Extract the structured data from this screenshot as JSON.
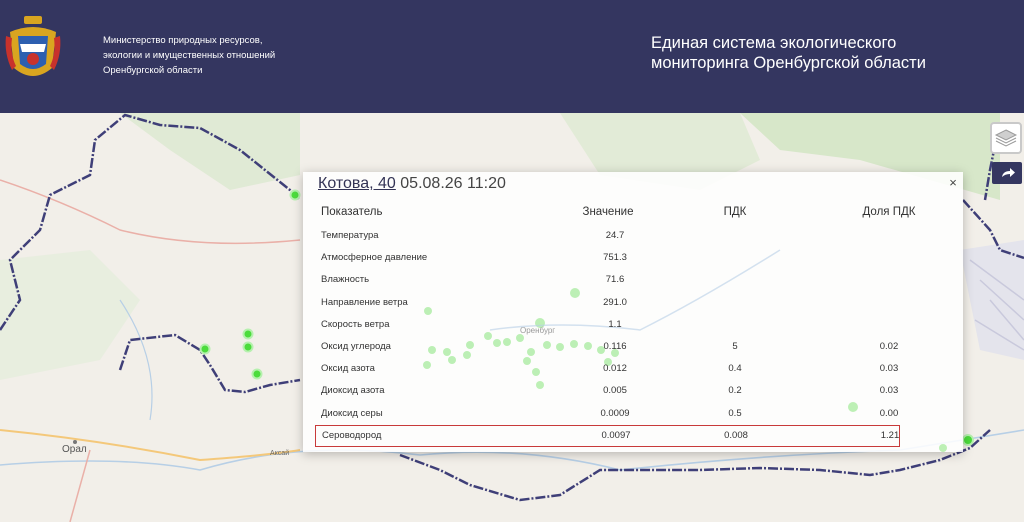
{
  "header": {
    "ministry_line1": "Министерство природных ресурсов,",
    "ministry_line2": "экологии и имущественных отношений",
    "ministry_line3": "Оренбургской области",
    "system_line1": "Единая система экологического",
    "system_line2": "мониторинга Оренбургской области"
  },
  "map": {
    "labels": {
      "oral": "Орал",
      "aksai": "Аксай",
      "orenburg": "Оренбург"
    },
    "colors": {
      "border": "#3f3f78",
      "station": "#4cdc3c"
    }
  },
  "controls": {
    "layers_icon": "layers-icon",
    "share_icon": "share-arrow-icon"
  },
  "popup": {
    "address": "Котова, 40",
    "datetime": "05.08.26 11:20",
    "close_symbol": "×",
    "columns": {
      "name": "Показатель",
      "value": "Значение",
      "pdk": "ПДК",
      "share": "Доля ПДК"
    },
    "rows": [
      {
        "name": "Температура",
        "value": "24.7",
        "pdk": "",
        "share": ""
      },
      {
        "name": "Атмосферное давление",
        "value": "751.3",
        "pdk": "",
        "share": ""
      },
      {
        "name": "Влажность",
        "value": "71.6",
        "pdk": "",
        "share": ""
      },
      {
        "name": "Направление ветра",
        "value": "291.0",
        "pdk": "",
        "share": ""
      },
      {
        "name": "Скорость ветра",
        "value": "1.1",
        "pdk": "",
        "share": ""
      },
      {
        "name": "Оксид углерода",
        "value": "0.116",
        "pdk": "5",
        "share": "0.02"
      },
      {
        "name": "Оксид азота",
        "value": "0.012",
        "pdk": "0.4",
        "share": "0.03"
      },
      {
        "name": "Диоксид азота",
        "value": "0.005",
        "pdk": "0.2",
        "share": "0.03"
      },
      {
        "name": "Диоксид серы",
        "value": "0.0009",
        "pdk": "0.5",
        "share": "0.00"
      },
      {
        "name": "Сероводород",
        "value": "0.0097",
        "pdk": "0.008",
        "share": "1.21"
      }
    ],
    "alert_color": "#c83a3a"
  }
}
